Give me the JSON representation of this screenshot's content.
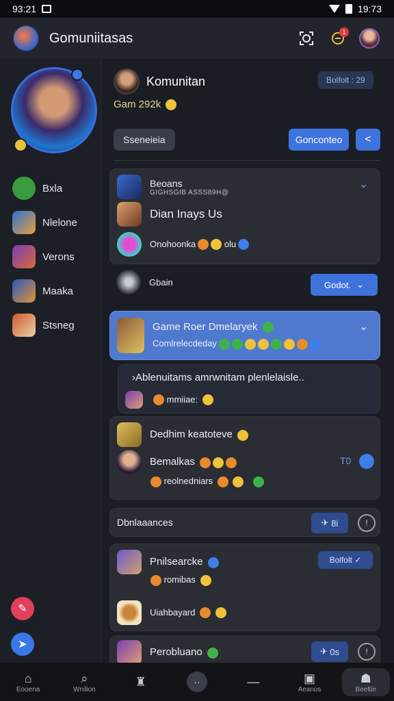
{
  "status": {
    "time_left": "93:21",
    "time_right": "19:73"
  },
  "appbar": {
    "title": "Gomuniitasas"
  },
  "sidebar": {
    "items": [
      {
        "label": "Bxla",
        "color": "#3a9b3e"
      },
      {
        "label": "Nlelone",
        "color": "#2d6fd6"
      },
      {
        "label": "Verons",
        "color": "#7a3db5"
      },
      {
        "label": "Maaka",
        "color": "#2b57c6"
      },
      {
        "label": "Stsneg",
        "color": "#c85a2c"
      }
    ]
  },
  "profile": {
    "name": "Komunitan",
    "pill": "Bolfolt : 29",
    "sub": "Gam 292k"
  },
  "actions": {
    "grey": "Sseneieia",
    "blue": "Gonconteo"
  },
  "card1": {
    "row1_title": "Beoans",
    "row1_sub": "GIGHSGIB ASSS89H@",
    "row2": "Dian Inays Us",
    "row3": "Onohoonka",
    "row3_tail": "olu"
  },
  "gbain": {
    "label": "Gbain",
    "button": "Godot."
  },
  "highlight": {
    "title": "Game Roer Dmelaryek",
    "sub": "Comlrelecdeday"
  },
  "notice": {
    "line1": "›Ablenuitams amrwnitam plenlelaisle..",
    "line2": "mmiiae:"
  },
  "card2": {
    "row1": "Dedhim keatoteve",
    "row2": "Bemalkas",
    "row2_right": "T0",
    "row3": "reolnedniars"
  },
  "section": {
    "label": "Dbnlaaances",
    "pill": "8i"
  },
  "card3": {
    "row1": "Pnilsearcke",
    "row1_pill": "Bolfolt",
    "row2": "romibas",
    "row3": "Uiahbayard"
  },
  "card4": {
    "row1": "Perobluano",
    "pill": "0s"
  },
  "bottomnav": {
    "items": [
      "Eooena",
      "Wnilion",
      "",
      "",
      "",
      "Aeanos",
      "Beeltie"
    ]
  }
}
